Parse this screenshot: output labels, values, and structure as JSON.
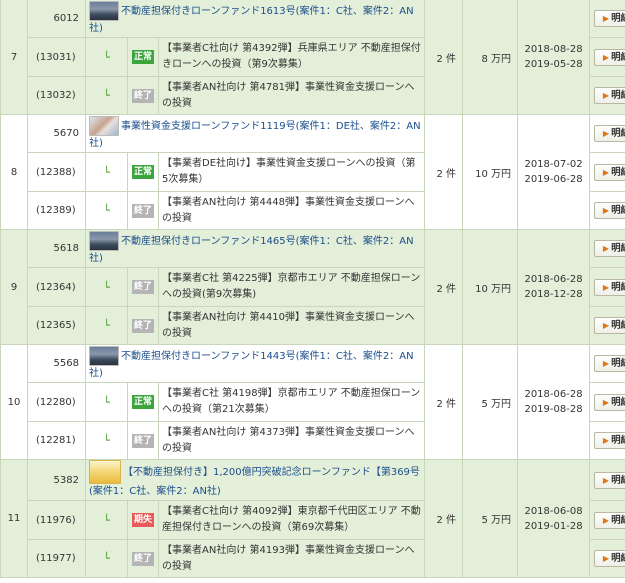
{
  "groups": [
    {
      "index": "7",
      "fund_id": "6012",
      "thumb": "city",
      "fund_name": "不動産担保付きローンファンド1613号(案件1：C社、案件2：AN社)",
      "count": "2 件",
      "amount": "8 万円",
      "date_start": "2018-08-28",
      "date_end": "2019-05-28",
      "loans": [
        {
          "id": "(13031)",
          "status": "正常",
          "status_color": "#3da53d",
          "desc": "【事業者C社向け 第4392弾】兵庫県エリア 不動産担保付きローンへの投資（第9次募集）"
        },
        {
          "id": "(13032)",
          "status": "終了",
          "status_color": "#b4b4b4",
          "desc": "【事業者AN社向け 第4781弾】事業性資金支援ローンへの投資"
        }
      ]
    },
    {
      "index": "8",
      "fund_id": "5670",
      "thumb": "hand",
      "fund_name": "事業性資金支援ローンファンド1119号(案件1：DE社、案件2：AN社)",
      "count": "2 件",
      "amount": "10 万円",
      "date_start": "2018-07-02",
      "date_end": "2019-06-28",
      "loans": [
        {
          "id": "(12388)",
          "status": "正常",
          "status_color": "#3da53d",
          "desc": "【事業者DE社向け】事業性資金支援ローンへの投資（第5次募集）"
        },
        {
          "id": "(12389)",
          "status": "終了",
          "status_color": "#b4b4b4",
          "desc": "【事業者AN社向け 第4448弾】事業性資金支援ローンへの投資"
        }
      ]
    },
    {
      "index": "9",
      "fund_id": "5618",
      "thumb": "city",
      "fund_name": "不動産担保付きローンファンド1465号(案件1：C社、案件2：AN社)",
      "count": "2 件",
      "amount": "10 万円",
      "date_start": "2018-06-28",
      "date_end": "2018-12-28",
      "loans": [
        {
          "id": "(12364)",
          "status": "終了",
          "status_color": "#b4b4b4",
          "desc": "【事業者C社 第4225弾】京都市エリア 不動産担保ローンへの投資(第9次募集)"
        },
        {
          "id": "(12365)",
          "status": "終了",
          "status_color": "#b4b4b4",
          "desc": "【事業者AN社向け 第4410弾】事業性資金支援ローンへの投資"
        }
      ]
    },
    {
      "index": "10",
      "fund_id": "5568",
      "thumb": "city",
      "fund_name": "不動産担保付きローンファンド1443号(案件1：C社、案件2：AN社)",
      "count": "2 件",
      "amount": "5 万円",
      "date_start": "2018-06-28",
      "date_end": "2019-08-28",
      "loans": [
        {
          "id": "(12280)",
          "status": "正常",
          "status_color": "#3da53d",
          "desc": "【事業者C社 第4198弾】京都市エリア 不動産担保ローンへの投資（第21次募集）"
        },
        {
          "id": "(12281)",
          "status": "終了",
          "status_color": "#b4b4b4",
          "desc": "【事業者AN社向け 第4373弾】事業性資金支援ローンへの投資"
        }
      ]
    },
    {
      "index": "11",
      "fund_id": "5382",
      "thumb": "gold",
      "fund_name": "【不動産担保付き】1,200億円突破記念ローンファンド【第369号(案件1：C社、案件2：AN社)",
      "count": "2 件",
      "amount": "5 万円",
      "date_start": "2018-06-08",
      "date_end": "2019-01-28",
      "loans": [
        {
          "id": "(11976)",
          "status": "期失",
          "status_color": "#e85a5a",
          "desc": "【事業者C社向け 第4092弾】東京都千代田区エリア 不動産担保付きローンへの投資（第69次募集）"
        },
        {
          "id": "(11977)",
          "status": "終了",
          "status_color": "#b4b4b4",
          "desc": "【事業者AN社向け 第4193弾】事業性資金支援ローンへの投資"
        }
      ]
    }
  ],
  "sub_arrow": "└",
  "detail_button_label": "明細",
  "detail_button_icon": "triangle-right-icon"
}
